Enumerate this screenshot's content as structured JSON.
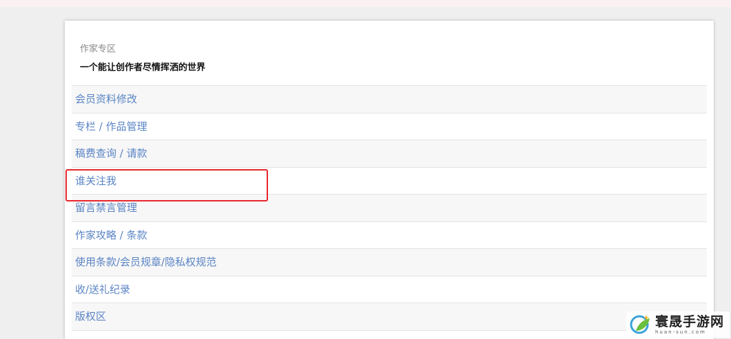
{
  "header": {
    "title": "作家专区",
    "subtitle": "一个能让创作者尽情挥洒的世界"
  },
  "menu": {
    "items": [
      {
        "label": "会员资料修改"
      },
      {
        "label": "专栏 / 作品管理"
      },
      {
        "label": "稿费查询 / 请款"
      },
      {
        "label": "谁关注我"
      },
      {
        "label": "留言禁言管理"
      },
      {
        "label": "作家攻略 / 条款"
      },
      {
        "label": "使用条款/会员规章/隐私权规范"
      },
      {
        "label": "收/送礼纪录"
      },
      {
        "label": "版权区"
      }
    ]
  },
  "watermark": {
    "brand": "寰晟手游网",
    "url": "huan-sun.com",
    "icon": "leaf-logo-icon"
  },
  "colors": {
    "link": "#5a84c4",
    "highlight": "#e8262b",
    "background": "#efefef",
    "top_strip": "#fbf1f3"
  }
}
